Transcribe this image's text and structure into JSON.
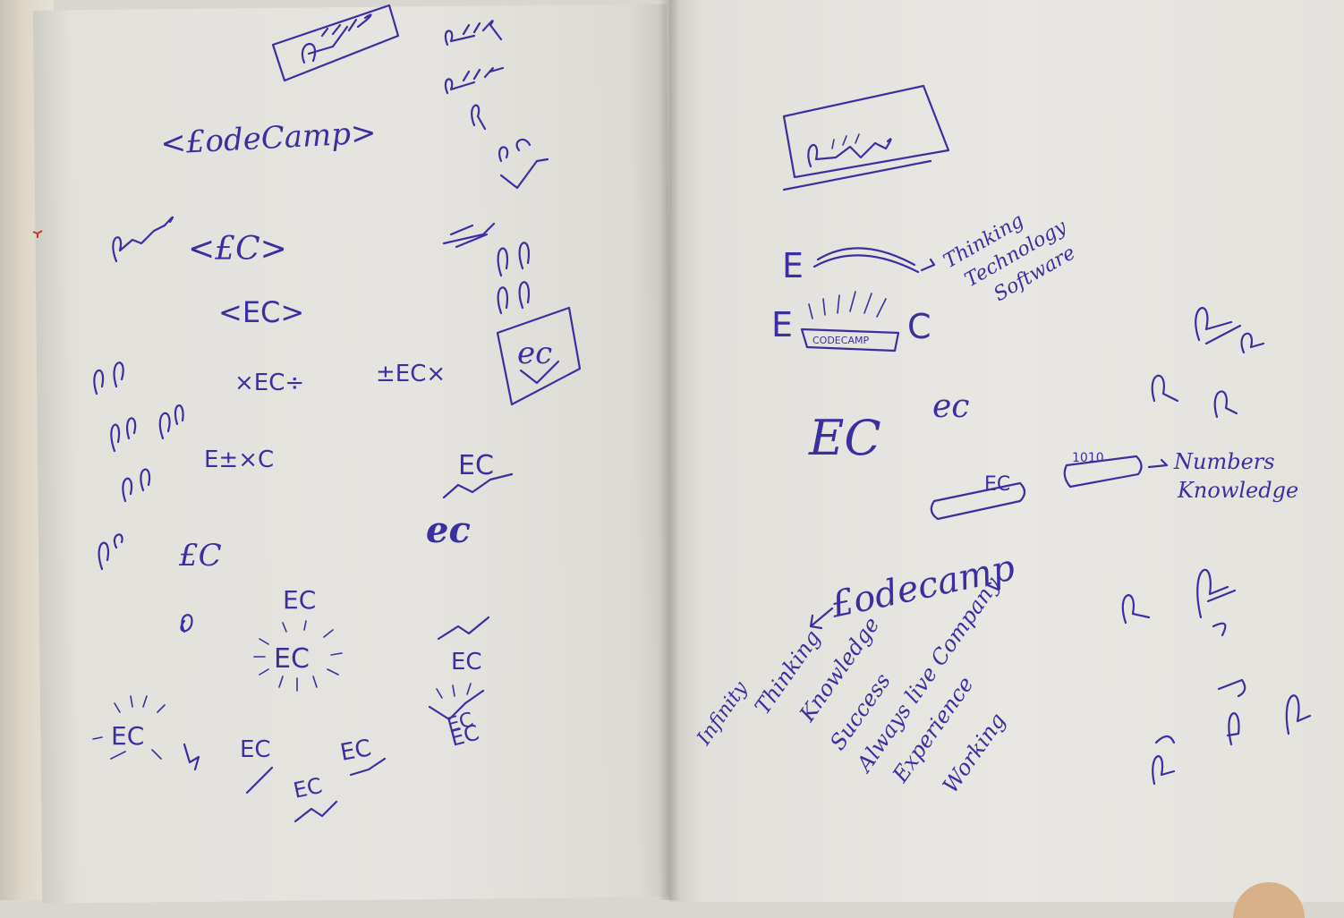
{
  "left_page": {
    "codecamp_tag": "<£odeCamp>",
    "ec_tag_script": "<£C>",
    "ec_tag_block": "<EC>",
    "ec_math_1": "×EC÷",
    "ec_math_2": "±EC×",
    "ec_math_3": "E±×C",
    "ec_boxed": "ec",
    "ec_right_1": "EC",
    "ec_right_2": "ec",
    "ec_sketch_1": "EC",
    "ec_sketch_2": "EC",
    "ec_sketch_3": "EC",
    "ec_sketch_4": "EC",
    "ec_sketch_5": "EC",
    "ec_sketch_6": "EC",
    "ec_sketch_7": "EC",
    "ec_sketch_8": "EC",
    "ec_sketch_9": "£C",
    "ec_sketch_10": "EC"
  },
  "right_page": {
    "banner_text": "CODECAMP",
    "arrow_note_1": "Thinking",
    "arrow_note_2": "Technology",
    "arrow_note_3": "Software",
    "ec_large": "EC",
    "ec_small": "ec",
    "tube_digits": "1010",
    "numbers_note_1": "Numbers",
    "numbers_note_2": "Knowledge",
    "codecamp_script": "£odecamp",
    "word_list": [
      "Infinity",
      "Thinking",
      "Knowledge",
      "Success",
      "Always live Company",
      "Experience",
      "Working"
    ]
  },
  "colors": {
    "ink": "#3a2fa0",
    "paper": "#e6e4e0",
    "margin_mark": "#c0392b"
  }
}
